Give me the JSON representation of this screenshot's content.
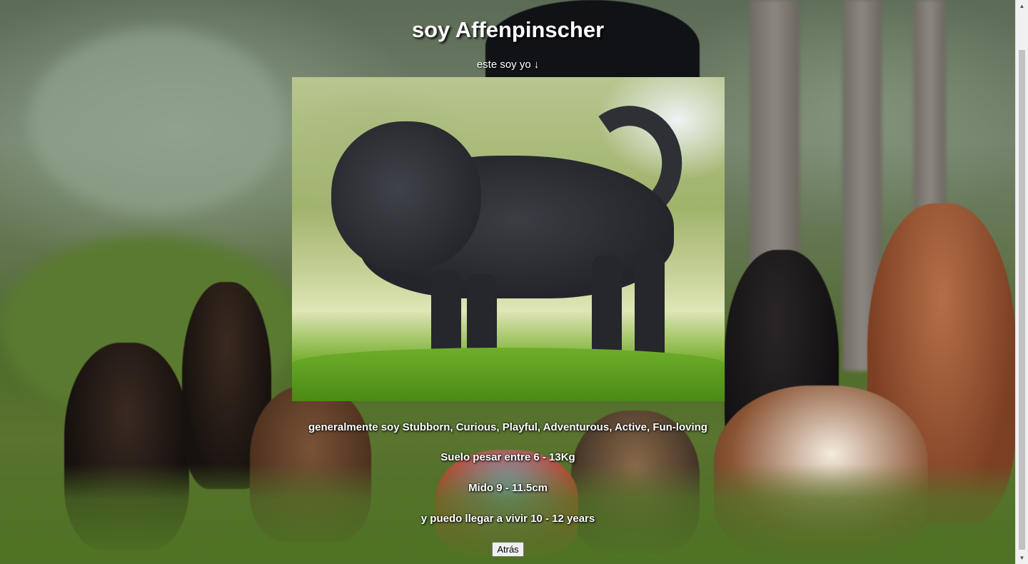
{
  "page": {
    "title": "soy Affenpinscher",
    "subtitle": "este soy yo",
    "subtitle_icon": "down-arrow-icon"
  },
  "dog_photo": {
    "alt": "Affenpinscher"
  },
  "info": {
    "temperament": "generalmente soy Stubborn, Curious, Playful, Adventurous, Active, Fun-loving",
    "weight": "Suelo pesar entre 6 - 13Kg",
    "height": "Mido 9 - 11.5cm",
    "life_span": "y puedo llegar a vivir 10 - 12 years"
  },
  "actions": {
    "back_label": "Atrás"
  },
  "colors": {
    "text": "#ffffff",
    "text_shadow": "#000000",
    "button_bg": "#efefef"
  }
}
